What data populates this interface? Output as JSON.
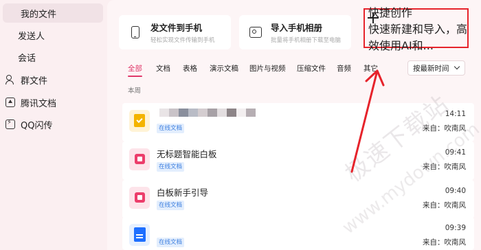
{
  "sidebar": {
    "items": [
      {
        "label": "我的文件",
        "icon": "grid-icon",
        "active": true
      },
      {
        "label": "发送人",
        "icon": "",
        "sub": true
      },
      {
        "label": "会话",
        "icon": "",
        "sub": true
      },
      {
        "label": "群文件",
        "icon": "people-icon"
      },
      {
        "label": "腾讯文档",
        "icon": "tencent-doc-icon"
      },
      {
        "label": "QQ闪传",
        "icon": "flash-icon"
      }
    ]
  },
  "cards": [
    {
      "title": "发文件到手机",
      "subtitle": "轻松实现文件传输到手机",
      "icon": "phone-icon"
    },
    {
      "title": "导入手机相册",
      "subtitle": "批量将手机相册下载至电脑",
      "icon": "album-icon"
    },
    {
      "title": "快捷创作",
      "subtitle": "快速新建和导入，高效使用AI和...",
      "icon": "plus-icon"
    }
  ],
  "tabs": [
    "全部",
    "文档",
    "表格",
    "演示文稿",
    "图片与视频",
    "压缩文件",
    "音频",
    "其它"
  ],
  "sort": {
    "label": "按最新时间"
  },
  "section_label": "本周",
  "files": [
    {
      "name": "",
      "badge": "在线文档",
      "time": "14:11",
      "from": "来自：吹南风",
      "icon": "yellow-doc-icon",
      "blurred": true
    },
    {
      "name": "无标题智能白板",
      "badge": "在线文档",
      "time": "09:41",
      "from": "来自：吹南风",
      "icon": "whiteboard-icon"
    },
    {
      "name": "白板新手引导",
      "badge": "在线文档",
      "time": "09:40",
      "from": "来自：吹南风",
      "icon": "whiteboard-icon"
    },
    {
      "name": "",
      "badge": "在线文档",
      "time": "09:39",
      "from": "来自：吹南风",
      "icon": "blue-doc-icon"
    }
  ],
  "watermark": {
    "text1": "极速下载站",
    "text2": "www.mydown.com"
  },
  "colors": {
    "accent": "#e0386a",
    "highlight": "#e6232b",
    "badge": "#3d7fe0"
  }
}
